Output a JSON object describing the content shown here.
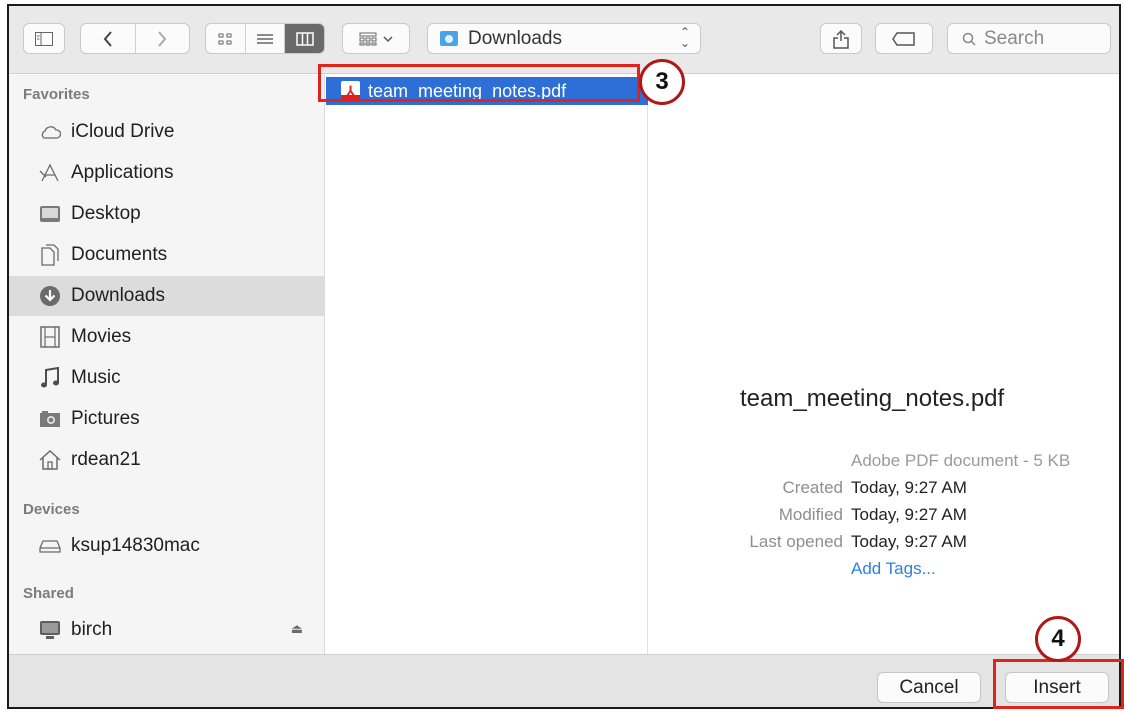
{
  "toolbar": {
    "path": "Downloads",
    "search_placeholder": "Search"
  },
  "sidebar": {
    "favorites_heading": "Favorites",
    "favorites": [
      {
        "label": "iCloud Drive",
        "icon": "cloud-icon"
      },
      {
        "label": "Applications",
        "icon": "applications-icon"
      },
      {
        "label": "Desktop",
        "icon": "desktop-icon"
      },
      {
        "label": "Documents",
        "icon": "documents-icon"
      },
      {
        "label": "Downloads",
        "icon": "downloads-icon",
        "selected": true
      },
      {
        "label": "Movies",
        "icon": "movies-icon"
      },
      {
        "label": "Music",
        "icon": "music-icon"
      },
      {
        "label": "Pictures",
        "icon": "pictures-icon"
      },
      {
        "label": "rdean21",
        "icon": "home-icon"
      }
    ],
    "devices_heading": "Devices",
    "devices": [
      {
        "label": "ksup14830mac",
        "icon": "drive-icon"
      }
    ],
    "shared_heading": "Shared",
    "shared": [
      {
        "label": "birch",
        "icon": "computer-icon"
      }
    ]
  },
  "file_list": {
    "selected_file": "team_meeting_notes.pdf"
  },
  "preview": {
    "filename": "team_meeting_notes.pdf",
    "kind": "Adobe PDF document - 5 KB",
    "created_label": "Created",
    "created_value": "Today, 9:27 AM",
    "modified_label": "Modified",
    "modified_value": "Today, 9:27 AM",
    "last_opened_label": "Last opened",
    "last_opened_value": "Today, 9:27 AM",
    "add_tags": "Add Tags..."
  },
  "footer": {
    "cancel_label": "Cancel",
    "insert_label": "Insert"
  },
  "annotations": {
    "step_3": "3",
    "step_4": "4",
    "highlight_color": "#e0241c"
  },
  "colors": {
    "selection": "#2d6fd6",
    "link": "#2f7fe0"
  }
}
